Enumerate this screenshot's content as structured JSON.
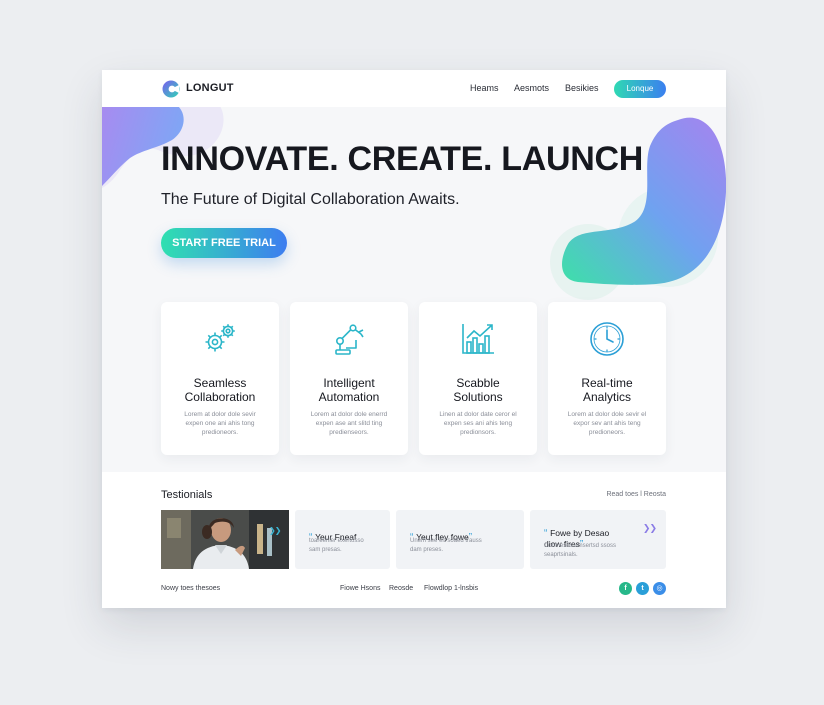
{
  "header": {
    "brand": "LONGUT",
    "nav": [
      "Heams",
      "Aesmots",
      "Besikies"
    ],
    "cta_label": "Lonque"
  },
  "hero": {
    "title": "INNOVATE. CREATE. LAUNCH",
    "subtitle": "The Future of Digital Collaboration Awaits.",
    "cta_label": "START FREE TRIAL"
  },
  "features": [
    {
      "icon": "gears-icon",
      "title": "Seamless\nCollaboration",
      "text": "Lorem at dolor dole sevir\nexpen one ani ahis tong\npredioneors."
    },
    {
      "icon": "robot-arm-icon",
      "title": "Intelligent\nAutomation",
      "text": "Lorem at dolor dole enerrd\nexpen ase ant slitd ting\npredienseors."
    },
    {
      "icon": "bar-chart-icon",
      "title": "Scabble\nSolutions",
      "text": "Linen at dolor date ceror el\nexpen ses ani ahis teng\npredionsors."
    },
    {
      "icon": "clock-icon",
      "title": "Real-time\nAnalytics",
      "text": "Lorem at dolor dole sevir el\nexpor sev ant ahis teng\npredioneors."
    }
  ],
  "testimonials": {
    "heading": "Testionials",
    "read_all": "Read toes l Reosta",
    "cards": [
      {
        "title": "Yeur Fneaf",
        "text": "toareenler exertosso\nsam presas."
      },
      {
        "title": "Yeut fley fowe",
        "text": "Unem see en soaed trauss\ndam preses."
      },
      {
        "title": "Fowe by Desao\ndiow fires",
        "text": "Comnesos umsertsd ssoss\nseaprtsinals."
      }
    ]
  },
  "footer": {
    "left_text": "Nowy toes thesoes",
    "links": [
      "Fiowe Hsons",
      "Reosde",
      "Flowdlop  1-lnsbis"
    ],
    "social": [
      {
        "icon": "facebook-icon",
        "glyph": "f",
        "color": "#27b88a"
      },
      {
        "icon": "twitter-icon",
        "glyph": "t",
        "color": "#2a9fd8"
      },
      {
        "icon": "dribbble-icon",
        "glyph": "◎",
        "color": "#3b8ee8"
      }
    ]
  },
  "colors": {
    "accent_teal": "#2fe0b0",
    "accent_blue": "#3d7df0",
    "accent_purple": "#8b7ce6"
  }
}
